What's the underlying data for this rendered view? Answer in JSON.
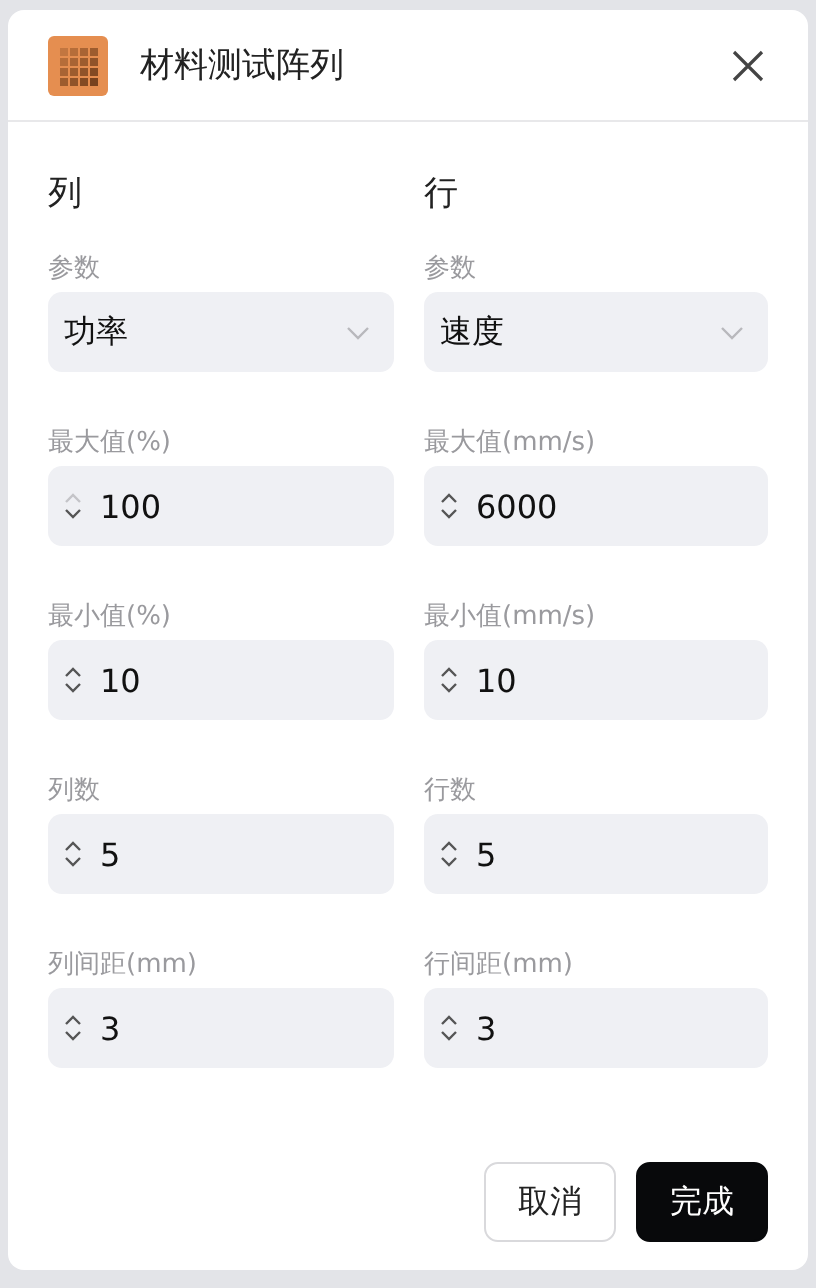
{
  "dialog": {
    "title": "材料测试阵列"
  },
  "columns": [
    {
      "heading": "列",
      "param_label": "参数",
      "param_value": "功率",
      "fields": [
        {
          "label": "最大值(%)",
          "value": "100",
          "up_disabled": true
        },
        {
          "label": "最小值(%)",
          "value": "10",
          "up_disabled": false
        },
        {
          "label": "列数",
          "value": "5",
          "up_disabled": false
        },
        {
          "label": "列间距(mm)",
          "value": "3",
          "up_disabled": false
        }
      ]
    },
    {
      "heading": "行",
      "param_label": "参数",
      "param_value": "速度",
      "fields": [
        {
          "label": "最大值(mm/s)",
          "value": "6000",
          "up_disabled": false
        },
        {
          "label": "最小值(mm/s)",
          "value": "10",
          "up_disabled": false
        },
        {
          "label": "行数",
          "value": "5",
          "up_disabled": false
        },
        {
          "label": "行间距(mm)",
          "value": "3",
          "up_disabled": false
        }
      ]
    }
  ],
  "buttons": [
    {
      "label": "取消",
      "kind": "secondary"
    },
    {
      "label": "完成",
      "kind": "primary"
    }
  ]
}
